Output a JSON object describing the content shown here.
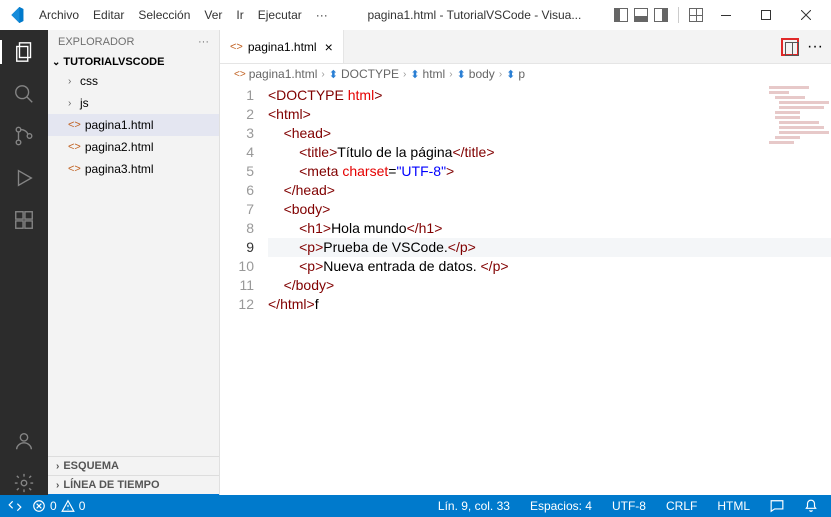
{
  "titlebar": {
    "menus": [
      "Archivo",
      "Editar",
      "Selección",
      "Ver",
      "Ir",
      "Ejecutar"
    ],
    "title": "pagina1.html - TutorialVSCode - Visua..."
  },
  "sidebar": {
    "header": "EXPLORADOR",
    "root": "TUTORIALVSCODE",
    "folders": [
      "css",
      "js"
    ],
    "files": [
      "pagina1.html",
      "pagina2.html",
      "pagina3.html"
    ],
    "selected": "pagina1.html",
    "sections": [
      "ESQUEMA",
      "LÍNEA DE TIEMPO"
    ]
  },
  "tab": {
    "label": "pagina1.html"
  },
  "breadcrumb": [
    "pagina1.html",
    "DOCTYPE",
    "html",
    "body",
    "p"
  ],
  "code": {
    "lines": [
      [
        {
          "t": "tag",
          "v": "<DOCTYPE "
        },
        {
          "t": "attr",
          "v": "html"
        },
        {
          "t": "tag",
          "v": ">"
        }
      ],
      [
        {
          "t": "tag",
          "v": "<html>"
        }
      ],
      [
        {
          "t": "txt",
          "v": "    "
        },
        {
          "t": "tag",
          "v": "<head>"
        }
      ],
      [
        {
          "t": "txt",
          "v": "        "
        },
        {
          "t": "tag",
          "v": "<title>"
        },
        {
          "t": "txt",
          "v": "Título de la página"
        },
        {
          "t": "tag",
          "v": "</title>"
        }
      ],
      [
        {
          "t": "txt",
          "v": "        "
        },
        {
          "t": "tag",
          "v": "<meta "
        },
        {
          "t": "attr",
          "v": "charset"
        },
        {
          "t": "txt",
          "v": "="
        },
        {
          "t": "str",
          "v": "\"UTF-8\""
        },
        {
          "t": "tag",
          "v": ">"
        }
      ],
      [
        {
          "t": "txt",
          "v": "    "
        },
        {
          "t": "tag",
          "v": "</head>"
        }
      ],
      [
        {
          "t": "txt",
          "v": "    "
        },
        {
          "t": "tag",
          "v": "<body>"
        }
      ],
      [
        {
          "t": "txt",
          "v": "        "
        },
        {
          "t": "tag",
          "v": "<h1>"
        },
        {
          "t": "txt",
          "v": "Hola mundo"
        },
        {
          "t": "tag",
          "v": "</h1>"
        }
      ],
      [
        {
          "t": "txt",
          "v": "        "
        },
        {
          "t": "tag",
          "v": "<p>"
        },
        {
          "t": "txt",
          "v": "Prueba de VSCode."
        },
        {
          "t": "tag",
          "v": "</p>"
        }
      ],
      [
        {
          "t": "txt",
          "v": "        "
        },
        {
          "t": "tag",
          "v": "<p>"
        },
        {
          "t": "txt",
          "v": "Nueva entrada de datos. "
        },
        {
          "t": "tag",
          "v": "</p>"
        }
      ],
      [
        {
          "t": "txt",
          "v": "    "
        },
        {
          "t": "tag",
          "v": "</body>"
        }
      ],
      [
        {
          "t": "tag",
          "v": "</html>"
        },
        {
          "t": "txt",
          "v": "f"
        }
      ]
    ],
    "currentLine": 9
  },
  "status": {
    "errors": "0",
    "warnings": "0",
    "cursor": "Lín. 9, col. 33",
    "spaces": "Espacios: 4",
    "encoding": "UTF-8",
    "eol": "CRLF",
    "lang": "HTML"
  }
}
